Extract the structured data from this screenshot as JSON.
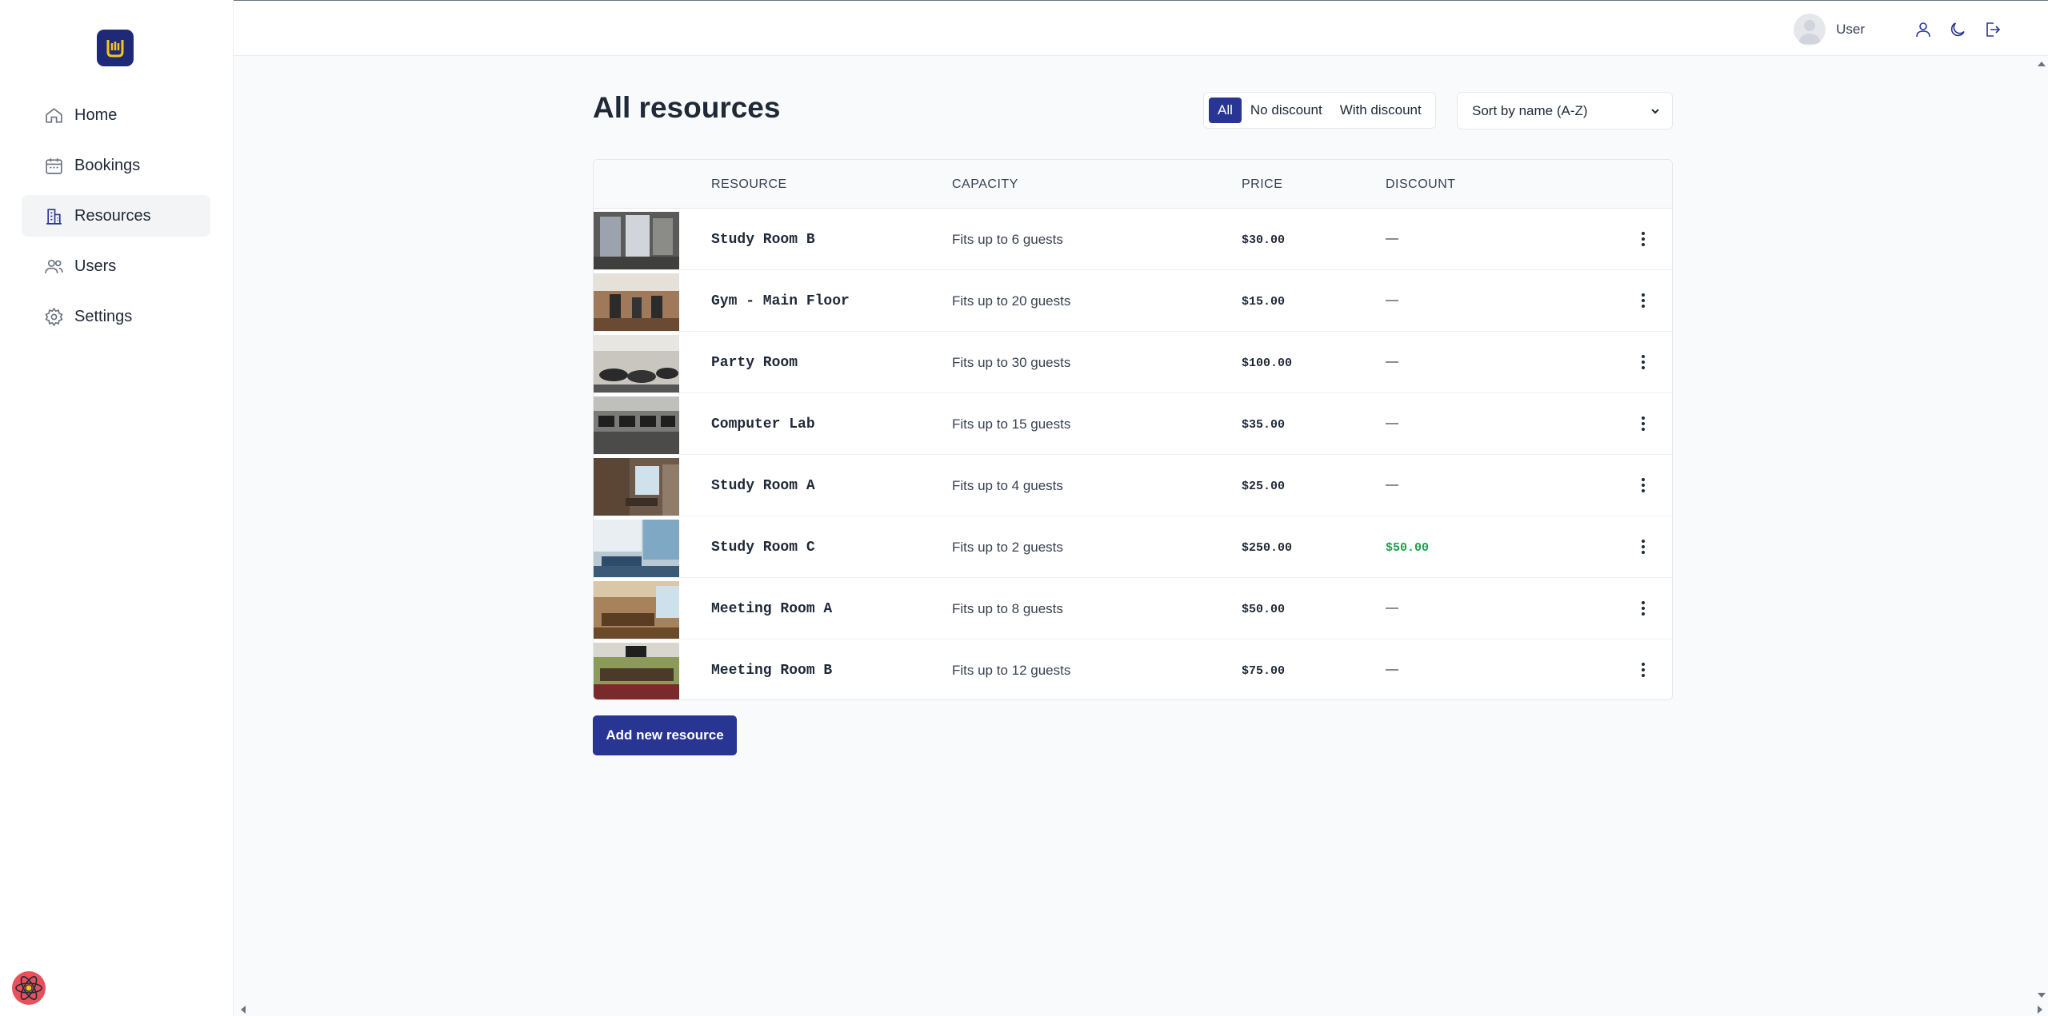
{
  "sidebar": {
    "items": [
      {
        "label": "Home",
        "icon": "home-icon"
      },
      {
        "label": "Bookings",
        "icon": "calendar-icon"
      },
      {
        "label": "Resources",
        "icon": "building-icon",
        "active": true
      },
      {
        "label": "Users",
        "icon": "users-icon"
      },
      {
        "label": "Settings",
        "icon": "gear-icon"
      }
    ]
  },
  "header": {
    "user_name": "User"
  },
  "main": {
    "title": "All resources",
    "filters": [
      {
        "label": "All",
        "active": true
      },
      {
        "label": "No discount",
        "active": false
      },
      {
        "label": "With discount",
        "active": false
      }
    ],
    "sort": {
      "selected": "Sort by name (A-Z)"
    },
    "columns": {
      "resource": "RESOURCE",
      "capacity": "CAPACITY",
      "price": "PRICE",
      "discount": "DISCOUNT"
    },
    "rows": [
      {
        "name": "Study Room B",
        "capacity": "Fits up to 6 guests",
        "price": "$30.00",
        "discount": "—"
      },
      {
        "name": "Gym - Main Floor",
        "capacity": "Fits up to 20 guests",
        "price": "$15.00",
        "discount": "—"
      },
      {
        "name": "Party Room",
        "capacity": "Fits up to 30 guests",
        "price": "$100.00",
        "discount": "—"
      },
      {
        "name": "Computer Lab",
        "capacity": "Fits up to 15 guests",
        "price": "$35.00",
        "discount": "—"
      },
      {
        "name": "Study Room A",
        "capacity": "Fits up to 4 guests",
        "price": "$25.00",
        "discount": "—"
      },
      {
        "name": "Study Room C",
        "capacity": "Fits up to 2 guests",
        "price": "$250.00",
        "discount": "$50.00"
      },
      {
        "name": "Meeting Room A",
        "capacity": "Fits up to 8 guests",
        "price": "$50.00",
        "discount": "—"
      },
      {
        "name": "Meeting Room B",
        "capacity": "Fits up to 12 guests",
        "price": "$75.00",
        "discount": "—"
      }
    ],
    "add_button": "Add new resource"
  },
  "colors": {
    "accent": "#283593",
    "logo_bg": "#1e2a78",
    "logo_fg": "#f5c518",
    "discount_green": "#16a34a"
  }
}
